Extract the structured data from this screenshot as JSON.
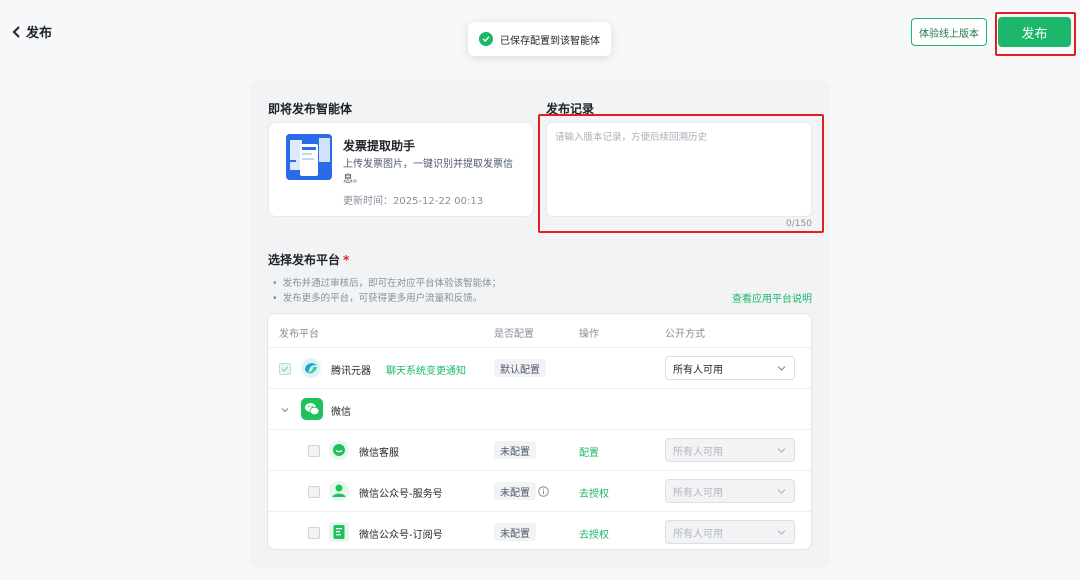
{
  "header": {
    "back_label": "发布",
    "toast_text": "已保存配置到该智能体",
    "trial_button": "体验线上版本",
    "publish_button": "发布",
    "accent_color": "#1cb76b"
  },
  "agent_section": {
    "title": "即将发布智能体",
    "name": "发票提取助手",
    "description": "上传发票图片，一键识别并提取发票信息。",
    "updated": "更新时间：2025-12-22 00:13"
  },
  "record_section": {
    "title": "发布记录",
    "placeholder": "请输入版本记录，方便后续回溯历史",
    "count": "0/150"
  },
  "platform_section": {
    "title": "选择发布平台",
    "required_mark": "*",
    "hints": [
      "发布并通过审核后，即可在对应平台体验该智能体；",
      "发布更多的平台，可获得更多用户流量和反馈。"
    ],
    "doc_link": "查看应用平台说明"
  },
  "table": {
    "headers": [
      "发布平台",
      "是否配置",
      "操作",
      "公开方式"
    ],
    "rows": [
      {
        "name": "腾讯元器",
        "icon": "yuanqi-icon",
        "link": "聊天系统变更通知",
        "status": "默认配置",
        "action": "",
        "visibility": "所有人可用",
        "checked": true,
        "enabled": true
      },
      {
        "name": "微信",
        "icon": "wechat-icon",
        "group": true
      },
      {
        "name": "微信客服",
        "icon": "wechat-service-icon",
        "status": "未配置",
        "action": "配置",
        "visibility": "所有人可用",
        "checked": false,
        "enabled": false
      },
      {
        "name": "微信公众号-服务号",
        "icon": "official-account-service-icon",
        "status": "未配置",
        "action": "去授权",
        "visibility": "所有人可用",
        "checked": false,
        "enabled": false,
        "info": true
      },
      {
        "name": "微信公众号-订阅号",
        "icon": "official-account-subscription-icon",
        "status": "未配置",
        "action": "去授权",
        "visibility": "所有人可用",
        "checked": false,
        "enabled": false
      }
    ]
  }
}
